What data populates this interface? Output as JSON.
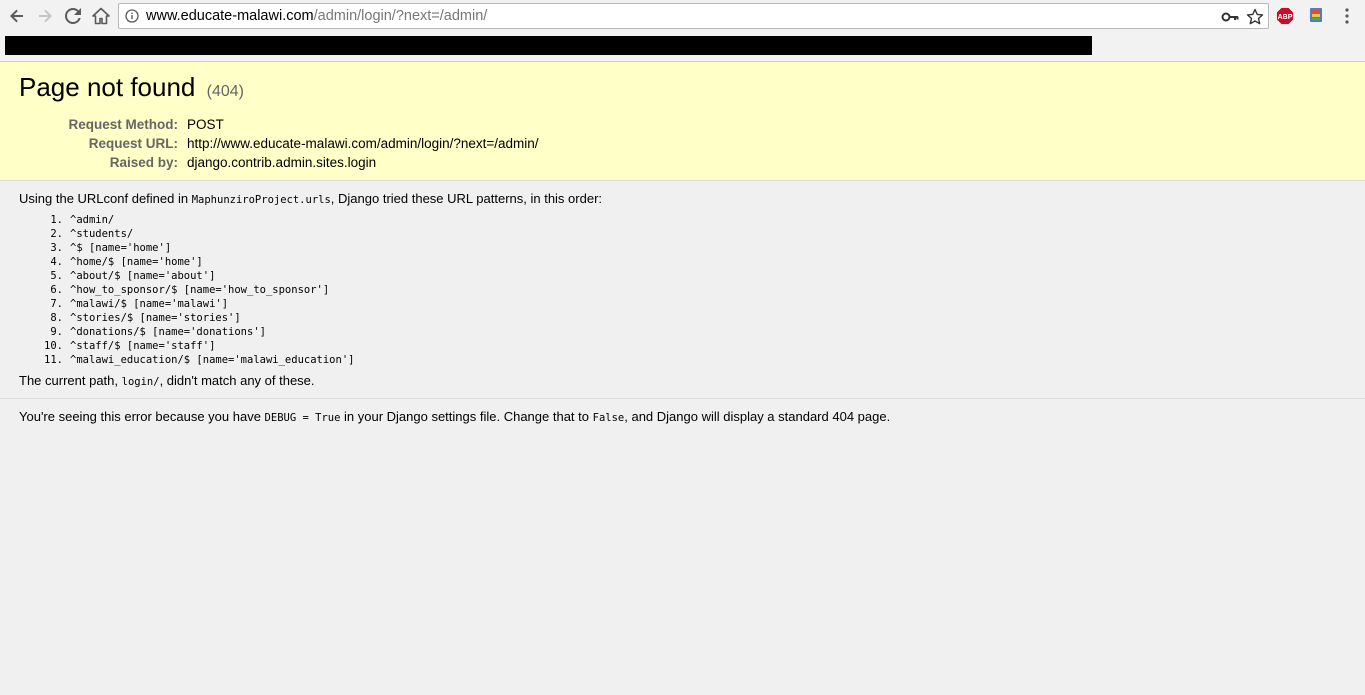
{
  "browser": {
    "back_icon": "arrow-back-icon",
    "forward_icon": "arrow-forward-icon",
    "reload_icon": "reload-icon",
    "home_icon": "home-icon",
    "url_host": "www.educate-malawi.com",
    "url_path": "/admin/login/?next=/admin/",
    "extension_abp_label": "ABP"
  },
  "summary": {
    "title": "Page not found",
    "status_code": "(404)",
    "meta": [
      {
        "key": "Request Method:",
        "value": "POST"
      },
      {
        "key": "Request URL:",
        "value": "http://www.educate-malawi.com/admin/login/?next=/admin/"
      },
      {
        "key": "Raised by:",
        "value": "django.contrib.admin.sites.login"
      }
    ]
  },
  "info": {
    "intro_prefix": "Using the URLconf defined in ",
    "intro_module": "MaphunziroProject.urls",
    "intro_suffix": ", Django tried these URL patterns, in this order:",
    "patterns": [
      {
        "num": "1.",
        "text": "^admin/"
      },
      {
        "num": "2.",
        "text": "^students/"
      },
      {
        "num": "3.",
        "text": "^$ [name='home']"
      },
      {
        "num": "4.",
        "text": "^home/$ [name='home']"
      },
      {
        "num": "5.",
        "text": "^about/$ [name='about']"
      },
      {
        "num": "6.",
        "text": "^how_to_sponsor/$ [name='how_to_sponsor']"
      },
      {
        "num": "7.",
        "text": "^malawi/$ [name='malawi']"
      },
      {
        "num": "8.",
        "text": "^stories/$ [name='stories']"
      },
      {
        "num": "9.",
        "text": "^donations/$ [name='donations']"
      },
      {
        "num": "10.",
        "text": "^staff/$ [name='staff']"
      },
      {
        "num": "11.",
        "text": "^malawi_education/$ [name='malawi_education']"
      }
    ],
    "current_prefix": "The current path, ",
    "current_path": "login/",
    "current_suffix": ", didn't match any of these."
  },
  "explanation": {
    "part1": "You're seeing this error because you have ",
    "debug_code": "DEBUG = True",
    "part2": " in your Django settings file. Change that to ",
    "false_code": "False",
    "part3": ", and Django will display a standard 404 page."
  }
}
